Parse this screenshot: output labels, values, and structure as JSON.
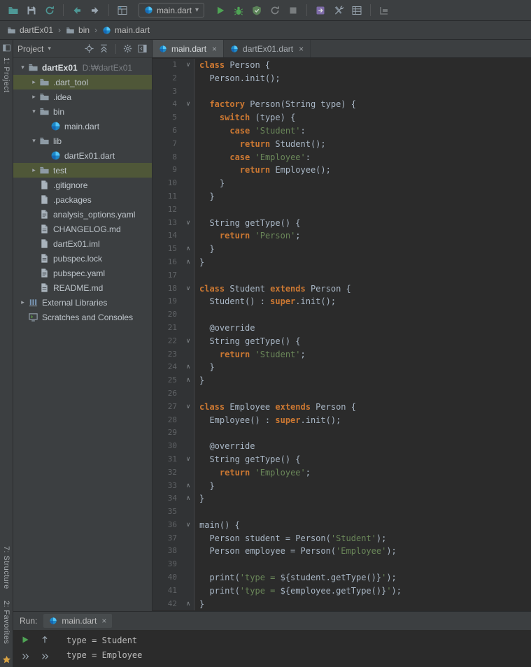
{
  "glyphs": {
    "chevron_down": "▾",
    "tree_expanded": "▾",
    "tree_collapsed": "▸",
    "close": "×",
    "fold_start": "∨",
    "fold_end": "∧",
    "breadcrumb_sep": "›"
  },
  "colors": {
    "panel_bg": "#3C3F41",
    "editor_bg": "#2B2B2B",
    "keyword": "#CC7832",
    "string": "#6A8759",
    "code_text": "#A9B7C6",
    "line_number": "#606366",
    "tree_selection": "#4F5738",
    "run_green": "#4FA455",
    "dart_blue": "#54C5F8"
  },
  "toolbar": {
    "left_icons": [
      "open-icon",
      "save-all-icon",
      "sync-icon",
      "sep",
      "back-icon",
      "forward-icon",
      "sep",
      "build-icon"
    ],
    "run_config": "main.dart",
    "right_icons": [
      "run-button",
      "debug-button",
      "coverage-button",
      "rerun-button",
      "stop-button",
      "sep",
      "attach-button",
      "tools-button",
      "structure-button",
      "sep",
      "layout-button"
    ]
  },
  "breadcrumbs": {
    "items": [
      {
        "label": "dartEx01",
        "icon": "folder-icon"
      },
      {
        "label": "bin",
        "icon": "folder-icon"
      },
      {
        "label": "main.dart",
        "icon": "dart-icon"
      }
    ]
  },
  "stripe": {
    "project": "1: Project",
    "structure": "7: Structure",
    "favorites": "2: Favorites"
  },
  "project_panel": {
    "title": "Project",
    "header_icons": [
      "locate-icon",
      "collapse-icon",
      "sep",
      "gear-icon",
      "hide-icon"
    ],
    "items": [
      {
        "label": "dartEx01",
        "path": "D:₩dartEx01",
        "indent": 0,
        "arrow": "down",
        "icon": "folder-icon",
        "bold": true
      },
      {
        "label": ".dart_tool",
        "indent": 1,
        "arrow": "right",
        "icon": "folder-icon",
        "selected": true
      },
      {
        "label": ".idea",
        "indent": 1,
        "arrow": "right",
        "icon": "folder-icon"
      },
      {
        "label": "bin",
        "indent": 1,
        "arrow": "down",
        "icon": "folder-icon"
      },
      {
        "label": "main.dart",
        "indent": 2,
        "icon": "dart-icon"
      },
      {
        "label": "lib",
        "indent": 1,
        "arrow": "down",
        "icon": "folder-icon"
      },
      {
        "label": "dartEx01.dart",
        "indent": 2,
        "icon": "dart-icon"
      },
      {
        "label": "test",
        "indent": 1,
        "arrow": "right",
        "icon": "folder-icon",
        "selected": true
      },
      {
        "label": ".gitignore",
        "indent": 1,
        "icon": "file-icon"
      },
      {
        "label": ".packages",
        "indent": 1,
        "icon": "file-icon"
      },
      {
        "label": "analysis_options.yaml",
        "indent": 1,
        "icon": "yaml-icon"
      },
      {
        "label": "CHANGELOG.md",
        "indent": 1,
        "icon": "text-icon"
      },
      {
        "label": "dartEx01.iml",
        "indent": 1,
        "icon": "file-icon"
      },
      {
        "label": "pubspec.lock",
        "indent": 1,
        "icon": "text-icon"
      },
      {
        "label": "pubspec.yaml",
        "indent": 1,
        "icon": "yaml-icon"
      },
      {
        "label": "README.md",
        "indent": 1,
        "icon": "text-icon"
      },
      {
        "label": "External Libraries",
        "indent": 0,
        "arrow": "right",
        "icon": "lib-icon"
      },
      {
        "label": "Scratches and Consoles",
        "indent": 0,
        "icon": "scratch-icon"
      }
    ]
  },
  "editor": {
    "tabs": [
      {
        "label": "main.dart",
        "icon": "dart-icon",
        "active": true
      },
      {
        "label": "dartEx01.dart",
        "icon": "dart-icon",
        "active": false
      }
    ],
    "lines": [
      {
        "n": 1,
        "fold": "start",
        "t": [
          [
            "k",
            "class"
          ],
          [
            "p",
            " Person {"
          ]
        ]
      },
      {
        "n": 2,
        "t": [
          [
            "p",
            "  Person.init();"
          ]
        ]
      },
      {
        "n": 3,
        "t": []
      },
      {
        "n": 4,
        "fold": "start",
        "t": [
          [
            "p",
            "  "
          ],
          [
            "k",
            "factory"
          ],
          [
            "p",
            " Person(String type) {"
          ]
        ]
      },
      {
        "n": 5,
        "t": [
          [
            "p",
            "    "
          ],
          [
            "k",
            "switch"
          ],
          [
            "p",
            " (type) {"
          ]
        ]
      },
      {
        "n": 6,
        "t": [
          [
            "p",
            "      "
          ],
          [
            "k",
            "case"
          ],
          [
            "p",
            " "
          ],
          [
            "s",
            "'Student'"
          ],
          [
            "p",
            ":"
          ]
        ]
      },
      {
        "n": 7,
        "t": [
          [
            "p",
            "        "
          ],
          [
            "k",
            "return"
          ],
          [
            "p",
            " Student();"
          ]
        ]
      },
      {
        "n": 8,
        "t": [
          [
            "p",
            "      "
          ],
          [
            "k",
            "case"
          ],
          [
            "p",
            " "
          ],
          [
            "s",
            "'Employee'"
          ],
          [
            "p",
            ":"
          ]
        ]
      },
      {
        "n": 9,
        "t": [
          [
            "p",
            "        "
          ],
          [
            "k",
            "return"
          ],
          [
            "p",
            " Employee();"
          ]
        ]
      },
      {
        "n": 10,
        "t": [
          [
            "p",
            "    }"
          ]
        ]
      },
      {
        "n": 11,
        "t": [
          [
            "p",
            "  }"
          ]
        ]
      },
      {
        "n": 12,
        "t": []
      },
      {
        "n": 13,
        "fold": "start",
        "t": [
          [
            "p",
            "  String getType() {"
          ]
        ]
      },
      {
        "n": 14,
        "t": [
          [
            "p",
            "    "
          ],
          [
            "k",
            "return"
          ],
          [
            "p",
            " "
          ],
          [
            "s",
            "'Person'"
          ],
          [
            "p",
            ";"
          ]
        ]
      },
      {
        "n": 15,
        "fold": "end",
        "t": [
          [
            "p",
            "  }"
          ]
        ]
      },
      {
        "n": 16,
        "fold": "end",
        "t": [
          [
            "p",
            "}"
          ]
        ]
      },
      {
        "n": 17,
        "t": []
      },
      {
        "n": 18,
        "fold": "start",
        "t": [
          [
            "k",
            "class"
          ],
          [
            "p",
            " Student "
          ],
          [
            "k",
            "extends"
          ],
          [
            "p",
            " Person {"
          ]
        ]
      },
      {
        "n": 19,
        "t": [
          [
            "p",
            "  Student() : "
          ],
          [
            "k",
            "super"
          ],
          [
            "p",
            ".init();"
          ]
        ]
      },
      {
        "n": 20,
        "t": []
      },
      {
        "n": 21,
        "t": [
          [
            "p",
            "  @override"
          ]
        ]
      },
      {
        "n": 22,
        "fold": "start",
        "t": [
          [
            "p",
            "  String getType() {"
          ]
        ]
      },
      {
        "n": 23,
        "t": [
          [
            "p",
            "    "
          ],
          [
            "k",
            "return"
          ],
          [
            "p",
            " "
          ],
          [
            "s",
            "'Student'"
          ],
          [
            "p",
            ";"
          ]
        ]
      },
      {
        "n": 24,
        "fold": "end",
        "t": [
          [
            "p",
            "  }"
          ]
        ]
      },
      {
        "n": 25,
        "fold": "end",
        "t": [
          [
            "p",
            "}"
          ]
        ]
      },
      {
        "n": 26,
        "t": []
      },
      {
        "n": 27,
        "fold": "start",
        "t": [
          [
            "k",
            "class"
          ],
          [
            "p",
            " Employee "
          ],
          [
            "k",
            "extends"
          ],
          [
            "p",
            " Person {"
          ]
        ]
      },
      {
        "n": 28,
        "t": [
          [
            "p",
            "  Employee() : "
          ],
          [
            "k",
            "super"
          ],
          [
            "p",
            ".init();"
          ]
        ]
      },
      {
        "n": 29,
        "t": []
      },
      {
        "n": 30,
        "t": [
          [
            "p",
            "  @override"
          ]
        ]
      },
      {
        "n": 31,
        "fold": "start",
        "t": [
          [
            "p",
            "  String getType() {"
          ]
        ]
      },
      {
        "n": 32,
        "t": [
          [
            "p",
            "    "
          ],
          [
            "k",
            "return"
          ],
          [
            "p",
            " "
          ],
          [
            "s",
            "'Employee'"
          ],
          [
            "p",
            ";"
          ]
        ]
      },
      {
        "n": 33,
        "fold": "end",
        "t": [
          [
            "p",
            "  }"
          ]
        ]
      },
      {
        "n": 34,
        "fold": "end",
        "t": [
          [
            "p",
            "}"
          ]
        ]
      },
      {
        "n": 35,
        "t": []
      },
      {
        "n": 36,
        "fold": "start",
        "t": [
          [
            "p",
            "main() {"
          ]
        ]
      },
      {
        "n": 37,
        "t": [
          [
            "p",
            "  Person student = Person("
          ],
          [
            "s",
            "'Student'"
          ],
          [
            "p",
            ");"
          ]
        ]
      },
      {
        "n": 38,
        "t": [
          [
            "p",
            "  Person employee = Person("
          ],
          [
            "s",
            "'Employee'"
          ],
          [
            "p",
            ");"
          ]
        ]
      },
      {
        "n": 39,
        "t": []
      },
      {
        "n": 40,
        "t": [
          [
            "p",
            "  print("
          ],
          [
            "s",
            "'type = "
          ],
          [
            "x",
            "${student.getType()}"
          ],
          [
            "s",
            "'"
          ],
          [
            "p",
            ");"
          ]
        ]
      },
      {
        "n": 41,
        "t": [
          [
            "p",
            "  print("
          ],
          [
            "s",
            "'type = "
          ],
          [
            "x",
            "${employee.getType()}"
          ],
          [
            "s",
            "'"
          ],
          [
            "p",
            ");"
          ]
        ]
      },
      {
        "n": 42,
        "fold": "end",
        "t": [
          [
            "p",
            "}"
          ]
        ]
      }
    ]
  },
  "run_panel": {
    "label": "Run:",
    "tab": {
      "label": "main.dart",
      "icon": "dart-icon"
    },
    "tool_icons": [
      "rerun-run-icon",
      "up-icon",
      "chevrons-icon",
      "chevrons-icon"
    ],
    "output": [
      "type = Student",
      "type = Employee"
    ]
  }
}
